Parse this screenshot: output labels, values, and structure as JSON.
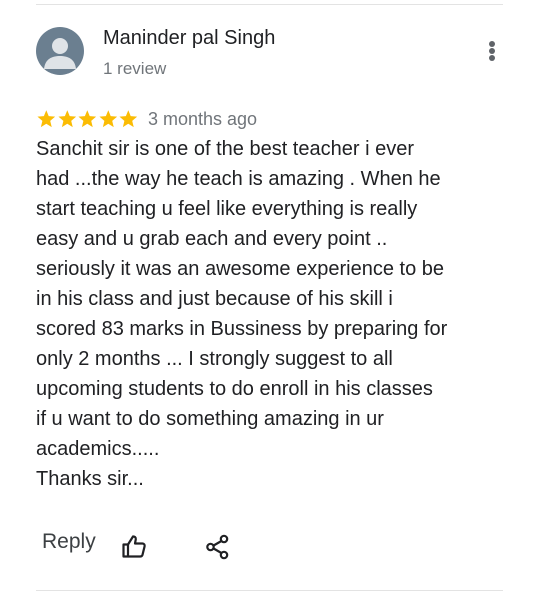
{
  "review": {
    "reviewer_name": "Maninder pal Singh",
    "review_count": "1 review",
    "avatar_icon": "person-avatar-icon",
    "more_icon": "more-vertical-icon",
    "rating": 5,
    "rating_max": 5,
    "star_color": "#fbbc04",
    "date": "3 months ago",
    "text_lines": [
      "Sanchit sir is one of the best teacher i ever",
      "had ...the way he teach is amazing . When he",
      "start teaching u feel like everything is really",
      "easy and u grab each and every point ..",
      "seriously it was an awesome experience to be",
      "in his class and just because of his skill i",
      "scored 83 marks in Bussiness by preparing for",
      "only 2 months ... I strongly suggest to all",
      "upcoming students to do enroll in his classes",
      "if u want to do something amazing in ur",
      "academics.....",
      "Thanks sir..."
    ]
  },
  "actions": {
    "reply_label": "Reply",
    "like_icon": "thumbs-up-icon",
    "share_icon": "share-icon"
  }
}
